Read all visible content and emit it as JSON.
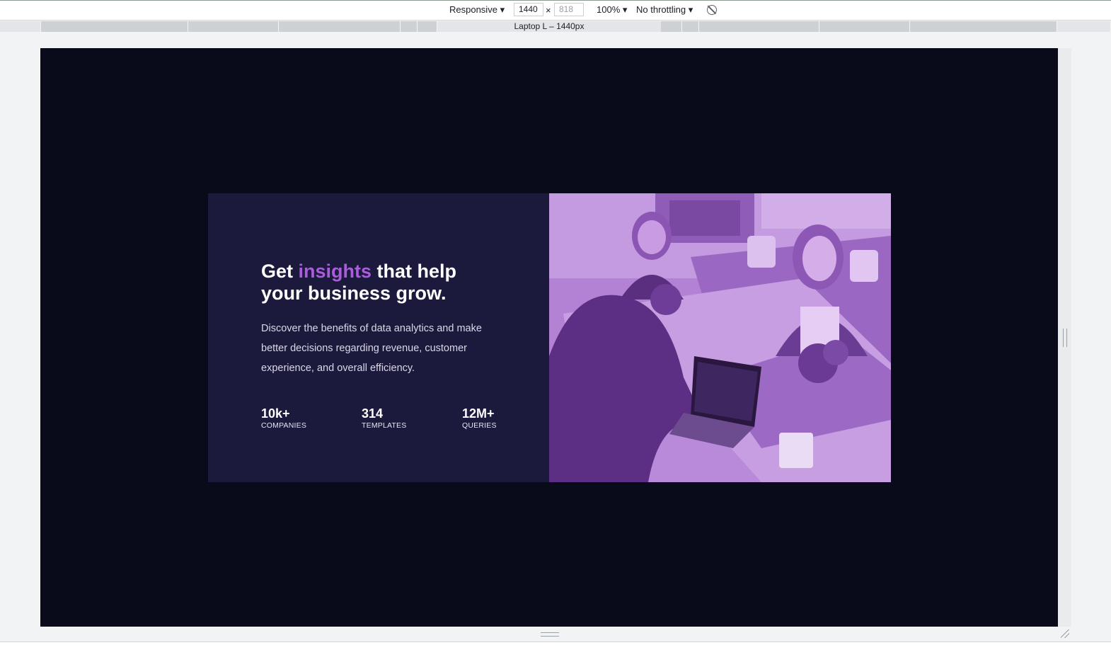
{
  "devtools": {
    "device_mode": "Responsive",
    "width": "1440",
    "height": "818",
    "times_symbol": "×",
    "zoom": "100%",
    "throttling": "No throttling",
    "media_query_label": "Laptop L – 1440px",
    "icons": [
      "rotate-icon",
      "dropdown-arrow-icon",
      "resize-handle-icon"
    ]
  },
  "hero": {
    "headline_part1": "Get ",
    "headline_accent": "insights",
    "headline_part2": " that help your business grow.",
    "description": "Discover the benefits of data analytics and make better decisions regarding revenue, customer experience, and overall efficiency.",
    "stats": [
      {
        "value": "10k+",
        "label": "COMPANIES"
      },
      {
        "value": "314",
        "label": "TEMPLATES"
      },
      {
        "value": "12M+",
        "label": "QUERIES"
      }
    ]
  },
  "colors": {
    "page_bg": "#090b1a",
    "card_bg": "#1c1a3c",
    "accent": "#aa5cdb",
    "photo_tint": "#b07bd3"
  }
}
